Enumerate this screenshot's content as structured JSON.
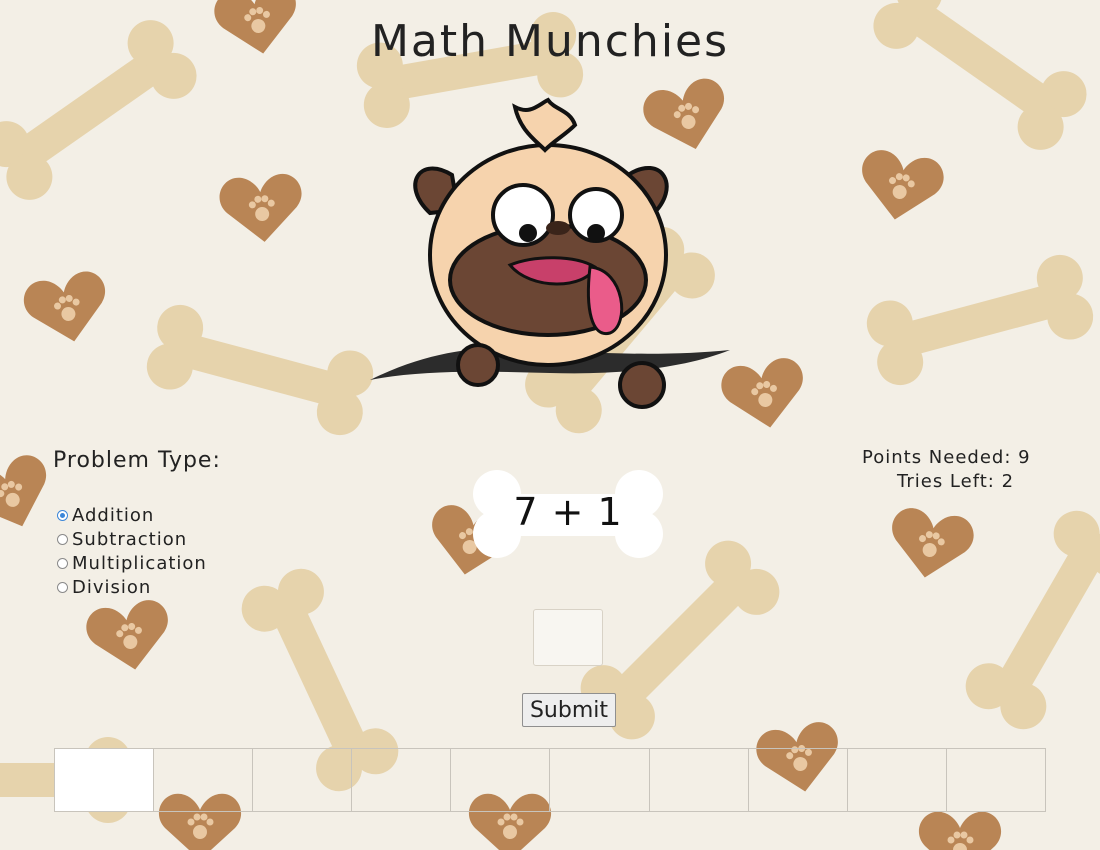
{
  "app": {
    "title": "Math Munchies"
  },
  "colors": {
    "background": "#f3efe6",
    "bone": "#e6d3ac",
    "heart": "#b98555",
    "selected_radio": "#3b86d9"
  },
  "problem_type": {
    "label": "Problem Type:",
    "options": [
      "Addition",
      "Subtraction",
      "Multiplication",
      "Division"
    ],
    "selected": "Addition"
  },
  "stats": {
    "points_needed": "Points Needed: 9",
    "tries_left": "Tries Left: 2"
  },
  "problem": {
    "expression": "7 + 1"
  },
  "answer": {
    "value": ""
  },
  "submit": {
    "label": "Submit"
  },
  "progress": {
    "total_cells": 10,
    "filled_cells": 1
  },
  "icons": {
    "mascot": "pug-mascot-icon",
    "background": "bones-and-paw-hearts-pattern"
  }
}
